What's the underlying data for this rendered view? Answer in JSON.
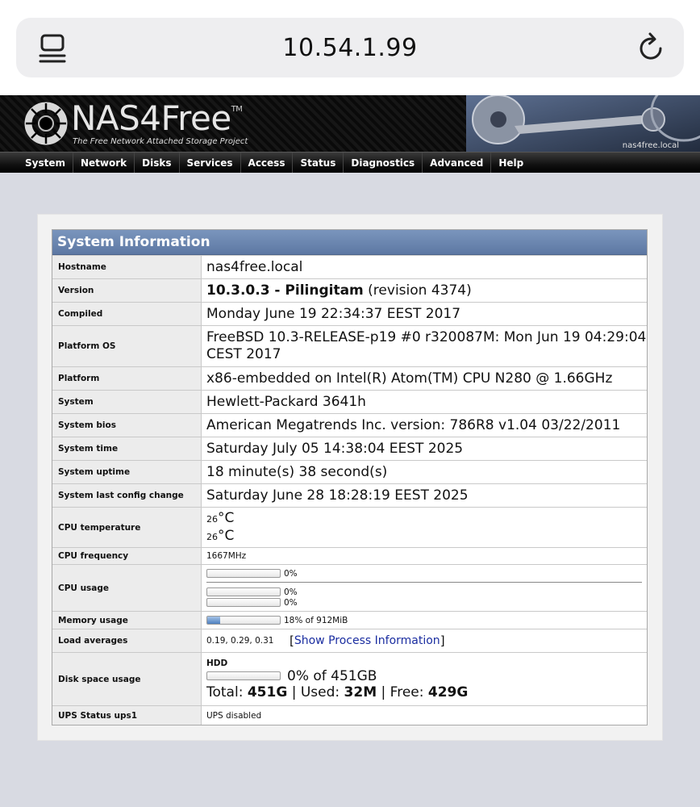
{
  "browser": {
    "url": "10.54.1.99",
    "tabs_icon": "tabs-icon",
    "reload_icon": "reload-icon"
  },
  "header": {
    "brand": "NAS4Free",
    "trademark": "TM",
    "tagline": "The Free Network Attached Storage Project",
    "hostname_label": "nas4free.local"
  },
  "nav": [
    "System",
    "Network",
    "Disks",
    "Services",
    "Access",
    "Status",
    "Diagnostics",
    "Advanced",
    "Help"
  ],
  "sysinfo": {
    "title": "System Information",
    "hostname_label": "Hostname",
    "hostname": "nas4free.local",
    "version_label": "Version",
    "version_bold": "10.3.0.3 - Pilingitam",
    "version_rest": "(revision 4374)",
    "compiled_label": "Compiled",
    "compiled": "Monday June 19 22:34:37 EEST 2017",
    "platform_os_label": "Platform OS",
    "platform_os": "FreeBSD 10.3-RELEASE-p19 #0 r320087M: Mon Jun 19 04:29:04 CEST 2017",
    "platform_label": "Platform",
    "platform": "x86-embedded on Intel(R) Atom(TM) CPU N280 @ 1.66GHz",
    "system_label": "System",
    "system": "Hewlett-Packard 3641h",
    "bios_label": "System bios",
    "bios": "American Megatrends Inc. version: 786R8 v1.04 03/22/2011",
    "time_label": "System time",
    "time": "Saturday July 05 14:38:04 EEST 2025",
    "uptime_label": "System uptime",
    "uptime": "18 minute(s) 38 second(s)",
    "config_label": "System last config change",
    "config": "Saturday June 28 18:28:19 EEST 2025",
    "cpu_temp_label": "CPU temperature",
    "cpu_temp_1": "26",
    "cpu_temp_2": "26",
    "cpu_temp_unit": "°C",
    "cpu_freq_label": "CPU frequency",
    "cpu_freq": "1667MHz",
    "cpu_usage_label": "CPU usage",
    "cpu_usage_total": "0%",
    "cpu_usage_core1": "0%",
    "cpu_usage_core2": "0%",
    "cpu_usage_total_value": 0,
    "cpu_usage_core1_value": 0,
    "cpu_usage_core2_value": 0,
    "memory_label": "Memory usage",
    "memory": "18% of 912MiB",
    "memory_value": 18,
    "load_label": "Load averages",
    "load": "0.19, 0.29, 0.31",
    "process_bracket_open": "[",
    "process_link": "Show Process Information",
    "process_bracket_close": "]",
    "disk_label": "Disk space usage",
    "disk_name": "HDD",
    "disk_usage": "0% of 451GB",
    "disk_usage_value": 0,
    "disk_total_label": "Total:",
    "disk_total": "451G",
    "disk_used_label": "Used:",
    "disk_used": "32M",
    "disk_free_label": "Free:",
    "disk_free": "429G",
    "disk_sep": "|",
    "ups_label": "UPS Status ups1",
    "ups": "UPS disabled"
  }
}
